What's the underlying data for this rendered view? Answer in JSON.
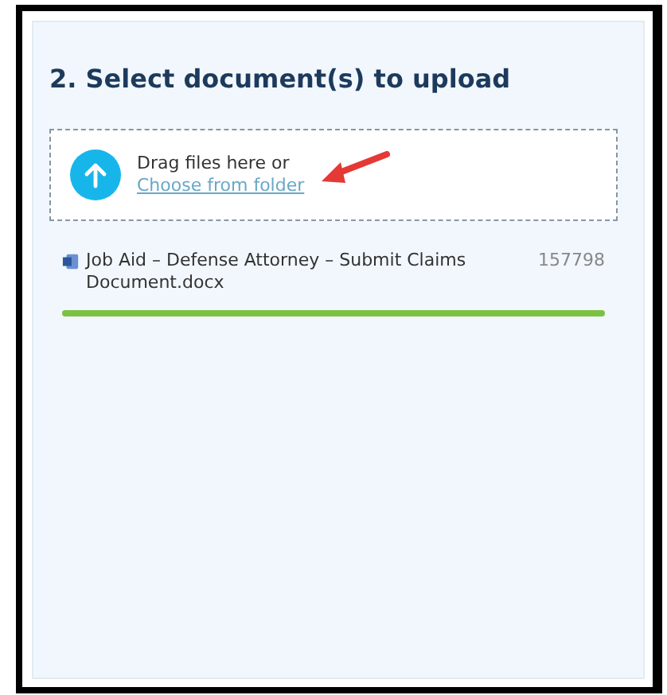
{
  "section": {
    "title": "2. Select document(s) to upload"
  },
  "dropzone": {
    "prompt": "Drag files here or",
    "link": "Choose from folder"
  },
  "files": [
    {
      "name": "Job Aid – Defense Attorney – Submit Claims Document.docx",
      "size": "157798",
      "level": 1
    }
  ]
}
